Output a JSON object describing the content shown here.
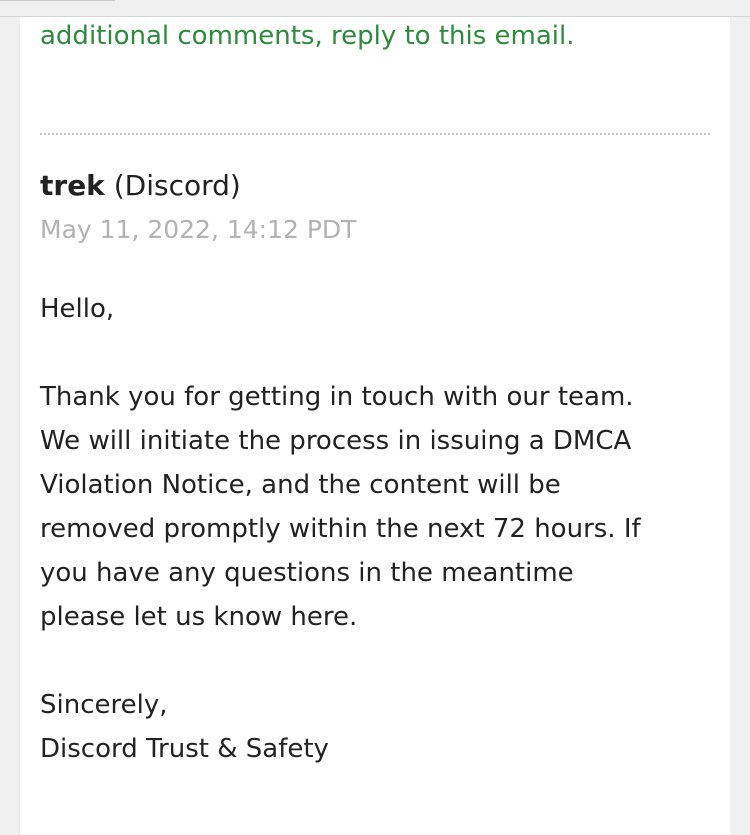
{
  "previous_message": {
    "text": "additional comments, reply to this email."
  },
  "message": {
    "sender_name": "trek",
    "sender_org": "(Discord)",
    "timestamp": "May 11, 2022, 14:12 PDT",
    "greeting": "Hello,",
    "paragraph_lines": [
      "Thank you for getting in touch with our team.",
      "We will initiate the process in issuing a DMCA",
      "Violation Notice, and the content will be",
      "removed promptly within the next 72 hours. If",
      "you have any questions in the meantime",
      "please let us know here."
    ],
    "signoff": "Sincerely,",
    "signature": "Discord Trust & Safety"
  },
  "colors": {
    "link_green": "#2e8b3e",
    "timestamp_gray": "#b3b3b3",
    "text": "#222222"
  }
}
